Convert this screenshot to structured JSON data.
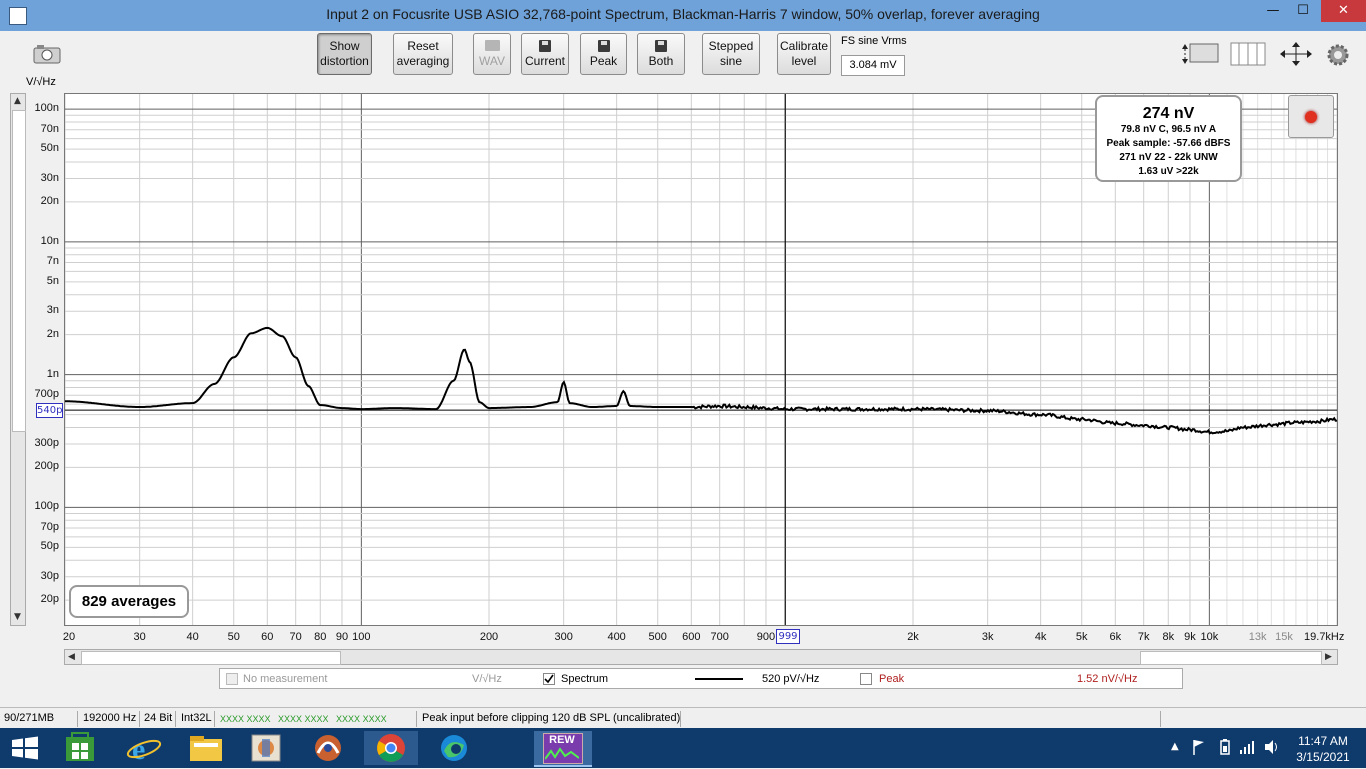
{
  "window": {
    "title": "Input 2 on Focusrite USB ASIO 32,768-point Spectrum, Blackman-Harris 7 window, 50% overlap, forever averaging",
    "minimize": "—",
    "maximize": "☐",
    "close": "✕"
  },
  "toolbar": {
    "show_distortion": [
      "Show",
      "distortion"
    ],
    "reset_averaging": [
      "Reset",
      "averaging"
    ],
    "wav": "WAV",
    "current": "Current",
    "peak": "Peak",
    "both": "Both",
    "stepped_sine": [
      "Stepped",
      "sine"
    ],
    "calibrate_level": [
      "Calibrate",
      "level"
    ],
    "fs_label": "FS sine Vrms",
    "fs_value": "3.084 mV"
  },
  "graph": {
    "y_unit": "V/√Hz",
    "y_cursor": "540p",
    "x_cursor": "999",
    "readout": {
      "main": "274 nV",
      "line1": "79.8 nV C, 96.5 nV A",
      "line2": "Peak sample: -57.66 dBFS",
      "line3": "271 nV 22 - 22k UNW",
      "line4": "1.63 uV >22k"
    },
    "averages": "829 averages"
  },
  "legend": {
    "no_measurement": "No measurement",
    "unit1": "V/√Hz",
    "spectrum": "Spectrum",
    "spectrum_value": "520 pV/√Hz",
    "peak": "Peak",
    "peak_value": "1.52 nV/√Hz"
  },
  "status": {
    "memory": "90/271MB",
    "rate": "192000 Hz",
    "bits": "24 Bit",
    "format": "Int32L",
    "meters": "XXXX XXXX   XXXX XXXX   XXXX XXXX",
    "message": "Peak input before clipping 120 dB SPL (uncalibrated)"
  },
  "taskbar": {
    "time": "11:47 AM",
    "date": "3/15/2021",
    "rew_label": "REW"
  },
  "chart_data": {
    "type": "line",
    "xlabel": "",
    "ylabel": "V/√Hz",
    "x_scale": "log",
    "y_scale": "log",
    "xlim": [
      20,
      20000
    ],
    "ylim": [
      1.3e-11,
      1.3e-07
    ],
    "y_ticks": [
      {
        "v": 1e-07,
        "label": "100n"
      },
      {
        "v": 7e-08,
        "label": "70n"
      },
      {
        "v": 5e-08,
        "label": "50n"
      },
      {
        "v": 3e-08,
        "label": "30n"
      },
      {
        "v": 2e-08,
        "label": "20n"
      },
      {
        "v": 1e-08,
        "label": "10n"
      },
      {
        "v": 7e-09,
        "label": "7n"
      },
      {
        "v": 5e-09,
        "label": "5n"
      },
      {
        "v": 3e-09,
        "label": "3n"
      },
      {
        "v": 2e-09,
        "label": "2n"
      },
      {
        "v": 1e-09,
        "label": "1n"
      },
      {
        "v": 7e-10,
        "label": "700p"
      },
      {
        "v": 3e-10,
        "label": "300p"
      },
      {
        "v": 2e-10,
        "label": "200p"
      },
      {
        "v": 1e-10,
        "label": "100p"
      },
      {
        "v": 7e-11,
        "label": "70p"
      },
      {
        "v": 5e-11,
        "label": "50p"
      },
      {
        "v": 3e-11,
        "label": "30p"
      },
      {
        "v": 2e-11,
        "label": "20p"
      }
    ],
    "x_ticks": [
      {
        "v": 20,
        "label": "20"
      },
      {
        "v": 30,
        "label": "30"
      },
      {
        "v": 40,
        "label": "40"
      },
      {
        "v": 50,
        "label": "50"
      },
      {
        "v": 60,
        "label": "60"
      },
      {
        "v": 70,
        "label": "70"
      },
      {
        "v": 80,
        "label": "80"
      },
      {
        "v": 90,
        "label": "90"
      },
      {
        "v": 100,
        "label": "100"
      },
      {
        "v": 200,
        "label": "200"
      },
      {
        "v": 300,
        "label": "300"
      },
      {
        "v": 400,
        "label": "400"
      },
      {
        "v": 500,
        "label": "500"
      },
      {
        "v": 600,
        "label": "600"
      },
      {
        "v": 700,
        "label": "700"
      },
      {
        "v": 900,
        "label": "900"
      },
      {
        "v": 2000,
        "label": "2k"
      },
      {
        "v": 3000,
        "label": "3k"
      },
      {
        "v": 4000,
        "label": "4k"
      },
      {
        "v": 5000,
        "label": "5k"
      },
      {
        "v": 6000,
        "label": "6k"
      },
      {
        "v": 7000,
        "label": "7k"
      },
      {
        "v": 8000,
        "label": "8k"
      },
      {
        "v": 9000,
        "label": "9k"
      },
      {
        "v": 10000,
        "label": "10k"
      },
      {
        "v": 13000,
        "label": "13k",
        "minor": true
      },
      {
        "v": 15000,
        "label": "15k",
        "minor": true
      },
      {
        "v": 19700,
        "label": "19.7kHz"
      }
    ],
    "series": [
      {
        "name": "Spectrum",
        "color": "#000000",
        "x": [
          20,
          30,
          40,
          45,
          50,
          55,
          60,
          65,
          70,
          75,
          80,
          90,
          100,
          120,
          150,
          165,
          175,
          180,
          190,
          200,
          250,
          290,
          300,
          310,
          350,
          400,
          415,
          430,
          500,
          600,
          700,
          800,
          900,
          1000,
          1500,
          2000,
          3000,
          4000,
          5000,
          6000,
          7000,
          8000,
          9000,
          10000,
          11000,
          12000,
          14000,
          16000,
          18000,
          19700
        ],
        "values": [
          6.3e-10,
          5.7e-10,
          6.1e-10,
          8.5e-10,
          1.35e-09,
          2.05e-09,
          2.25e-09,
          1.95e-09,
          1.35e-09,
          8.2e-10,
          5.9e-10,
          5.6e-10,
          5.5e-10,
          5.6e-10,
          5.5e-10,
          9e-10,
          1.55e-09,
          1.25e-09,
          6.2e-10,
          5.6e-10,
          5.7e-10,
          6.2e-10,
          8.8e-10,
          6.1e-10,
          5.7e-10,
          5.8e-10,
          7.5e-10,
          5.8e-10,
          5.7e-10,
          5.7e-10,
          5.8e-10,
          5.7e-10,
          5.6e-10,
          5.5e-10,
          5.5e-10,
          5.5e-10,
          5.35e-10,
          5e-10,
          4.6e-10,
          4.3e-10,
          4.15e-10,
          4e-10,
          3.85e-10,
          3.7e-10,
          3.75e-10,
          4e-10,
          4.2e-10,
          4.35e-10,
          4.45e-10,
          4.6e-10
        ]
      }
    ],
    "cursor": {
      "x": 999,
      "y": 5.4e-10
    },
    "grid": true
  }
}
